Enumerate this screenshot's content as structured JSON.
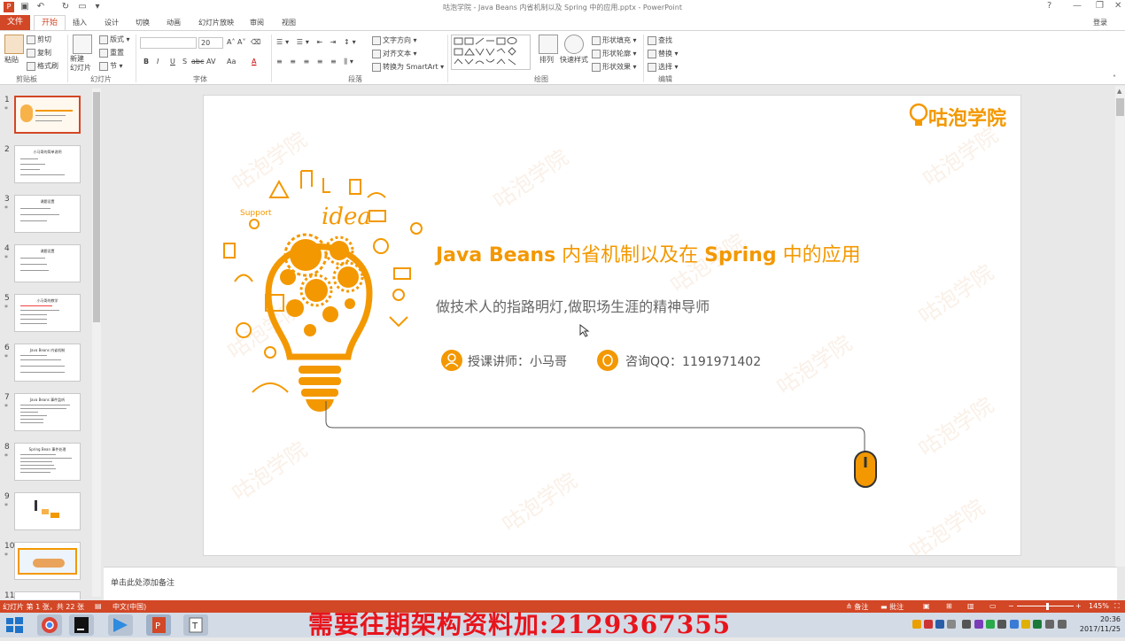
{
  "window": {
    "title": "咕泡学院 - Java Beans 内省机制以及 Spring 中的应用.pptx - PowerPoint",
    "help": "?",
    "minimize": "—",
    "restore": "❐",
    "close": "✕"
  },
  "tabs": {
    "file": "文件",
    "home": "开始",
    "insert": "插入",
    "design": "设计",
    "transitions": "切换",
    "animations": "动画",
    "slideshow": "幻灯片放映",
    "review": "审阅",
    "view": "视图",
    "login": "登录"
  },
  "ribbon": {
    "clipboard": {
      "group": "剪贴板",
      "paste": "粘贴",
      "cut": "剪切",
      "copy": "复制",
      "format_painter": "格式刷"
    },
    "slides": {
      "group": "幻灯片",
      "new_slide": "新建\n幻灯片",
      "layout": "版式",
      "reset": "重置",
      "section": "节"
    },
    "font": {
      "group": "字体",
      "size": "20",
      "bold": "B",
      "italic": "I",
      "underline": "U",
      "shadow": "S",
      "strike": "abc",
      "spacing": "AV",
      "case": "Aa",
      "color": "A"
    },
    "paragraph": {
      "group": "段落",
      "text_direction": "文字方向",
      "align_text": "对齐文本",
      "smartart": "转换为 SmartArt"
    },
    "drawing": {
      "group": "绘图",
      "arrange": "排列",
      "quick_styles": "快速样式",
      "shape_fill": "形状填充",
      "shape_outline": "形状轮廓",
      "shape_effects": "形状效果"
    },
    "editing": {
      "group": "编辑",
      "find": "查找",
      "replace": "替换",
      "select": "选择"
    }
  },
  "thumbnails": [
    {
      "num": "1",
      "title": "Java Beans 内省机制以及 Spring 中的应用"
    },
    {
      "num": "2",
      "title": "小马哥的简单说明"
    },
    {
      "num": "3",
      "title": "课题设置"
    },
    {
      "num": "4",
      "title": "课题设置"
    },
    {
      "num": "5",
      "title": "小马哥的教学"
    },
    {
      "num": "6",
      "title": "Java Beans 内省机制"
    },
    {
      "num": "7",
      "title": "Java Beans 事件监听"
    },
    {
      "num": "8",
      "title": "Spring Bean 事件处理"
    },
    {
      "num": "9",
      "title": ""
    },
    {
      "num": "10",
      "title": ""
    },
    {
      "num": "11",
      "title": ""
    }
  ],
  "slide": {
    "logo": "咕泡学院",
    "title_a": "Java Beans",
    "title_b": " 内省机制以及在 ",
    "title_c": "Spring",
    "title_d": " 中的应用",
    "subtitle": "做技术人的指路明灯,做职场生涯的精神导师",
    "teacher": "授课讲师：小马哥",
    "qq": "咨询QQ：1191971402",
    "watermark": "咕泡学院",
    "idea": "idea",
    "support": "Support"
  },
  "notes": {
    "placeholder": "单击此处添加备注"
  },
  "status": {
    "slide_info": "幻灯片 第 1 张，共 22 张",
    "language": "中文(中国)",
    "notes": "备注",
    "comments": "批注",
    "zoom": "145%"
  },
  "taskbar": {
    "promo": "需要往期架构资料加:2129367355",
    "time": "20:36",
    "date": "2017/11/25"
  },
  "colors": {
    "accent": "#d24726",
    "orange": "#f39800"
  }
}
